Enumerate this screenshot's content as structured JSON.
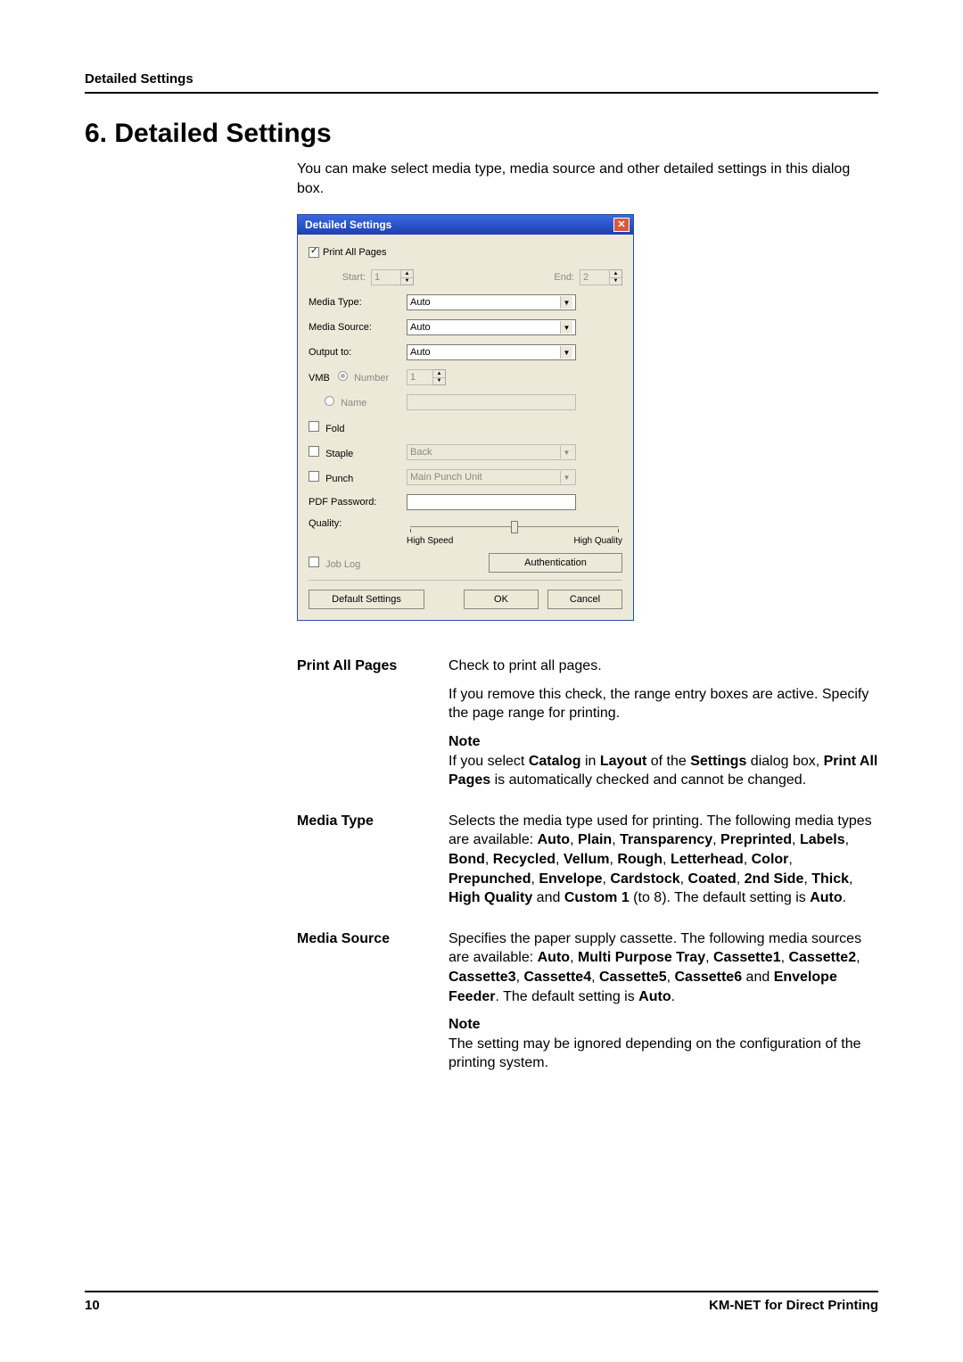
{
  "header": {
    "running": "Detailed Settings"
  },
  "title": "6.  Detailed Settings",
  "intro": "You can make select media type, media source and other detailed settings in this dialog box.",
  "dialog": {
    "title": "Detailed Settings",
    "close": "✕",
    "print_all": {
      "label": "Print All Pages"
    },
    "range": {
      "start": "Start:",
      "start_val": "1",
      "end": "End:",
      "end_val": "2"
    },
    "media_type": {
      "label": "Media Type:",
      "value": "Auto"
    },
    "media_source": {
      "label": "Media Source:",
      "value": "Auto"
    },
    "output": {
      "label": "Output to:",
      "value": "Auto"
    },
    "vmb": {
      "label": "VMB",
      "number_label": "Number",
      "number_val": "1",
      "name_label": "Name"
    },
    "fold": {
      "label": "Fold"
    },
    "staple": {
      "label": "Staple",
      "value": "Back"
    },
    "punch": {
      "label": "Punch",
      "value": "Main Punch Unit"
    },
    "pdfpw": {
      "label": "PDF Password:"
    },
    "quality": {
      "label": "Quality:",
      "left": "High Speed",
      "right": "High Quality"
    },
    "joblog": {
      "label": "Job Log",
      "auth": "Authentication"
    },
    "buttons": {
      "defaults": "Default Settings",
      "ok": "OK",
      "cancel": "Cancel"
    }
  },
  "docs": {
    "print_all": {
      "term": "Print All Pages",
      "p1": "Check to print all pages.",
      "p2": "If you remove this check, the range entry boxes are active. Specify the page range for printing.",
      "note_head": "Note",
      "note_a": "If you select ",
      "note_b": "Catalog",
      "note_c": " in ",
      "note_d": "Layout",
      "note_e": " of the ",
      "note_f": "Settings",
      "note_g": " dialog box, ",
      "note_h": "Print All Pages",
      "note_i": " is automatically checked and cannot be changed."
    },
    "media_type": {
      "term": "Media Type",
      "a": "Selects the media type used for printing. The following media types are available: ",
      "b": "Auto",
      "c": "Plain",
      "d": "Transparency",
      "e": "Preprinted",
      "f": "Labels",
      "g": "Bond",
      "h": "Recycled",
      "i": "Vellum",
      "j": "Rough",
      "k": "Letterhead",
      "l": "Color",
      "m": "Prepunched",
      "n": "Envelope",
      "o": "Cardstock",
      "p": "Coated",
      "q": "2nd Side",
      "r": "Thick",
      "s": "High Quality",
      "t_and": " and ",
      "t": "Custom 1",
      "u": " (to 8). The default setting is ",
      "v": "Auto",
      "w": "."
    },
    "media_source": {
      "term": "Media Source",
      "a": "Specifies the paper supply cassette. The following media sources are available: ",
      "b": "Auto",
      "c": "Multi Purpose Tray",
      "d": "Cassette1",
      "e": "Cassette2",
      "f": "Cassette3",
      "g": "Cassette4",
      "h": "Cassette5",
      "i": "Cassette6",
      "j_and": " and ",
      "j": "Envelope Feeder",
      "k": ". The default setting is ",
      "l": "Auto",
      "m": ".",
      "note_head": "Note",
      "note": "The setting may be ignored depending on the configuration of the printing system."
    }
  },
  "footer": {
    "page": "10",
    "product": "KM-NET for Direct Printing"
  }
}
